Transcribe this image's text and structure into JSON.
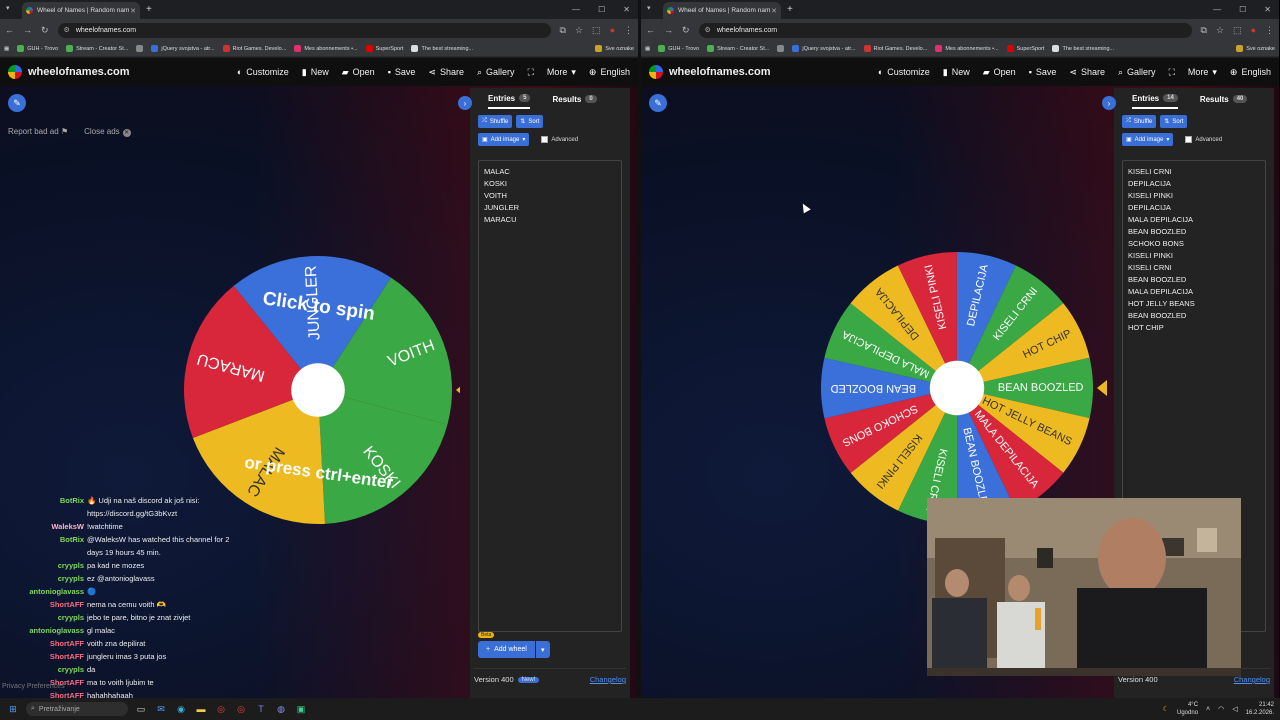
{
  "browser": {
    "tab_title": "Wheel of Names | Random nam",
    "url": "wheelofnames.com",
    "bookmarks": [
      "GUH - Trovo",
      "Stream - Creator St...",
      "jQuery svojstva - atr...",
      "Riot Games. Develo...",
      "Mes abonnements •...",
      "SuperSport",
      "The best streaming..."
    ],
    "bookmarks_folder": "Sve oznake"
  },
  "site": {
    "logo": "wheelofnames.com",
    "nav": [
      "Customize",
      "New",
      "Open",
      "Save",
      "Share",
      "Gallery",
      "More",
      "English"
    ],
    "report_ad": "Report bad ad",
    "close_ads": "Close ads",
    "tab_entries": "Entries",
    "tab_results": "Results",
    "shuffle": "Shuffle",
    "sort": "Sort",
    "add_image": "Add image",
    "advanced": "Advanced",
    "add_wheel": "Add wheel",
    "beta": "Beta",
    "version": "Version 400",
    "new_badge": "New!",
    "changelog": "Changelog"
  },
  "left": {
    "entries_count": "5",
    "results_count": "0",
    "entries": [
      "MALAC",
      "KOSKI",
      "VOITH",
      "JUNGLER",
      "MARACU"
    ],
    "wheel_text_top": "Click to spin",
    "wheel_text_bottom": "or press ctrl+enter"
  },
  "right": {
    "entries_count": "14",
    "results_count": "40",
    "entries": [
      "KISELI CRNI",
      "DEPILACIJA",
      "KISELI PINKI",
      "DEPILACIJA",
      "MALA DEPILACIJA",
      "BEAN BOOZLED",
      "SCHOKO BONS",
      "KISELI PINKI",
      "KISELI CRNI",
      "BEAN BOOZLED",
      "MALA DEPILACIJA",
      "HOT JELLY BEANS",
      "BEAN BOOZLED",
      "HOT CHIP"
    ]
  },
  "chat": [
    {
      "user": "BotRix",
      "color": "#7ed957",
      "text": "🔥 Udji na naš discord ak još nisi: https://discord.gg/tG3bKvzt"
    },
    {
      "user": "WaleksW",
      "color": "#ffb3c6",
      "text": "!watchtime"
    },
    {
      "user": "BotRix",
      "color": "#7ed957",
      "text": "@WaleksW has watched this channel for 2 days 19 hours 45 min."
    },
    {
      "user": "cryypls",
      "color": "#7ed957",
      "text": "pa kad ne mozes"
    },
    {
      "user": "cryypls",
      "color": "#7ed957",
      "text": "ez @antonioglavass"
    },
    {
      "user": "antonioglavass",
      "color": "#7ed957",
      "text": "🔵"
    },
    {
      "user": "ShortAFF",
      "color": "#ff6b81",
      "text": "nema na cemu voith 🫶"
    },
    {
      "user": "cryypls",
      "color": "#7ed957",
      "text": "jebo te pare, bitno je znat zivjet"
    },
    {
      "user": "antonioglavass",
      "color": "#7ed957",
      "text": "gl malac"
    },
    {
      "user": "ShortAFF",
      "color": "#ff6b81",
      "text": "voith zna depilirat"
    },
    {
      "user": "ShortAFF",
      "color": "#ff6b81",
      "text": "jungleru imas 3 puta jos"
    },
    {
      "user": "cryypls",
      "color": "#7ed957",
      "text": "da"
    },
    {
      "user": "ShortAFF",
      "color": "#ff6b81",
      "text": "ma to voith ljubim te"
    },
    {
      "user": "ShortAFF",
      "color": "#ff6b81",
      "text": "hahahhahaah"
    }
  ],
  "privacy": "Privacy Preferences",
  "taskbar": {
    "search_placeholder": "Pretraživanje",
    "weather": "4°C",
    "weather_sub": "Ugodno",
    "time": "21:42",
    "date": "16.2.2026."
  },
  "colors": {
    "red": "#d8263b",
    "green": "#3aa844",
    "yellow": "#eeba21",
    "blue": "#3b6fd9",
    "accent": "#3a6fd8"
  }
}
